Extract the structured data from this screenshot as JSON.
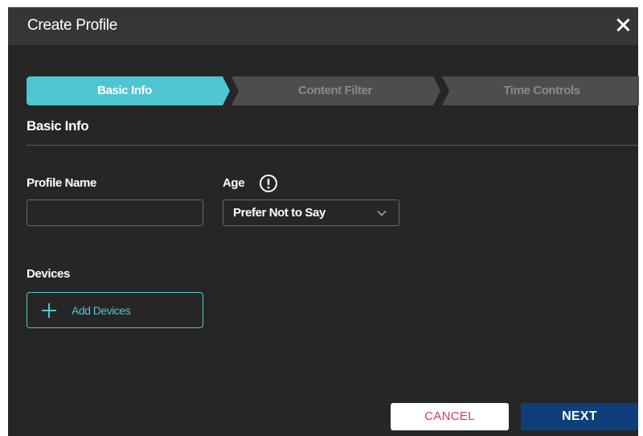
{
  "window": {
    "title": "Create Profile"
  },
  "stepper": {
    "steps": [
      {
        "label": "Basic Info",
        "active": true
      },
      {
        "label": "Content Filter",
        "active": false
      },
      {
        "label": "Time Controls",
        "active": false
      }
    ]
  },
  "section": {
    "title": "Basic Info"
  },
  "form": {
    "profile_name": {
      "label": "Profile Name",
      "value": "",
      "placeholder": ""
    },
    "age": {
      "label": "Age",
      "selected": "Prefer Not to Say"
    },
    "devices": {
      "label": "Devices",
      "add_label": "Add Devices"
    }
  },
  "footer": {
    "cancel_label": "CANCEL",
    "next_label": "NEXT"
  },
  "colors": {
    "accent": "#4fc6d3",
    "background": "#262626",
    "titlebar": "#363636",
    "inactive_step": "#4d4d4d",
    "cancel_text": "#d4396a",
    "next_button": "#0e3f7a"
  },
  "icons": {
    "close": "close-icon",
    "info": "exclamation-circle-icon",
    "dropdown": "chevron-down-icon",
    "add": "plus-icon"
  }
}
